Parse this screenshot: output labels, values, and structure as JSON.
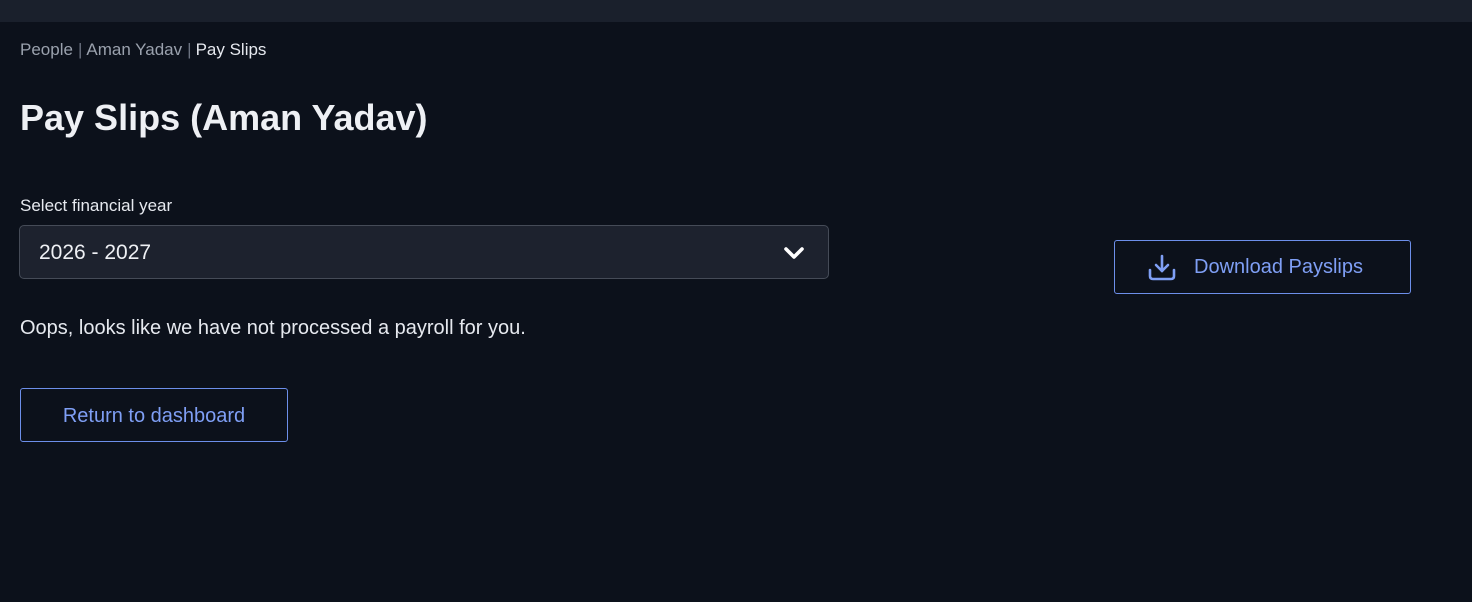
{
  "breadcrumb": {
    "items": [
      "People",
      "Aman Yadav",
      "Pay Slips"
    ],
    "separator": "|"
  },
  "page": {
    "title": "Pay Slips (Aman Yadav)"
  },
  "financial_year": {
    "label": "Select financial year",
    "selected": "2026 - 2027",
    "icon": "chevron-down-icon"
  },
  "empty_state": {
    "message": "Oops, looks like we have not processed a payroll for you."
  },
  "actions": {
    "return_label": "Return to dashboard",
    "download_label": "Download Payslips",
    "download_icon": "download-icon"
  },
  "colors": {
    "background": "#0c111b",
    "accent": "#7f9ff5",
    "border_accent": "#6d8fea"
  }
}
